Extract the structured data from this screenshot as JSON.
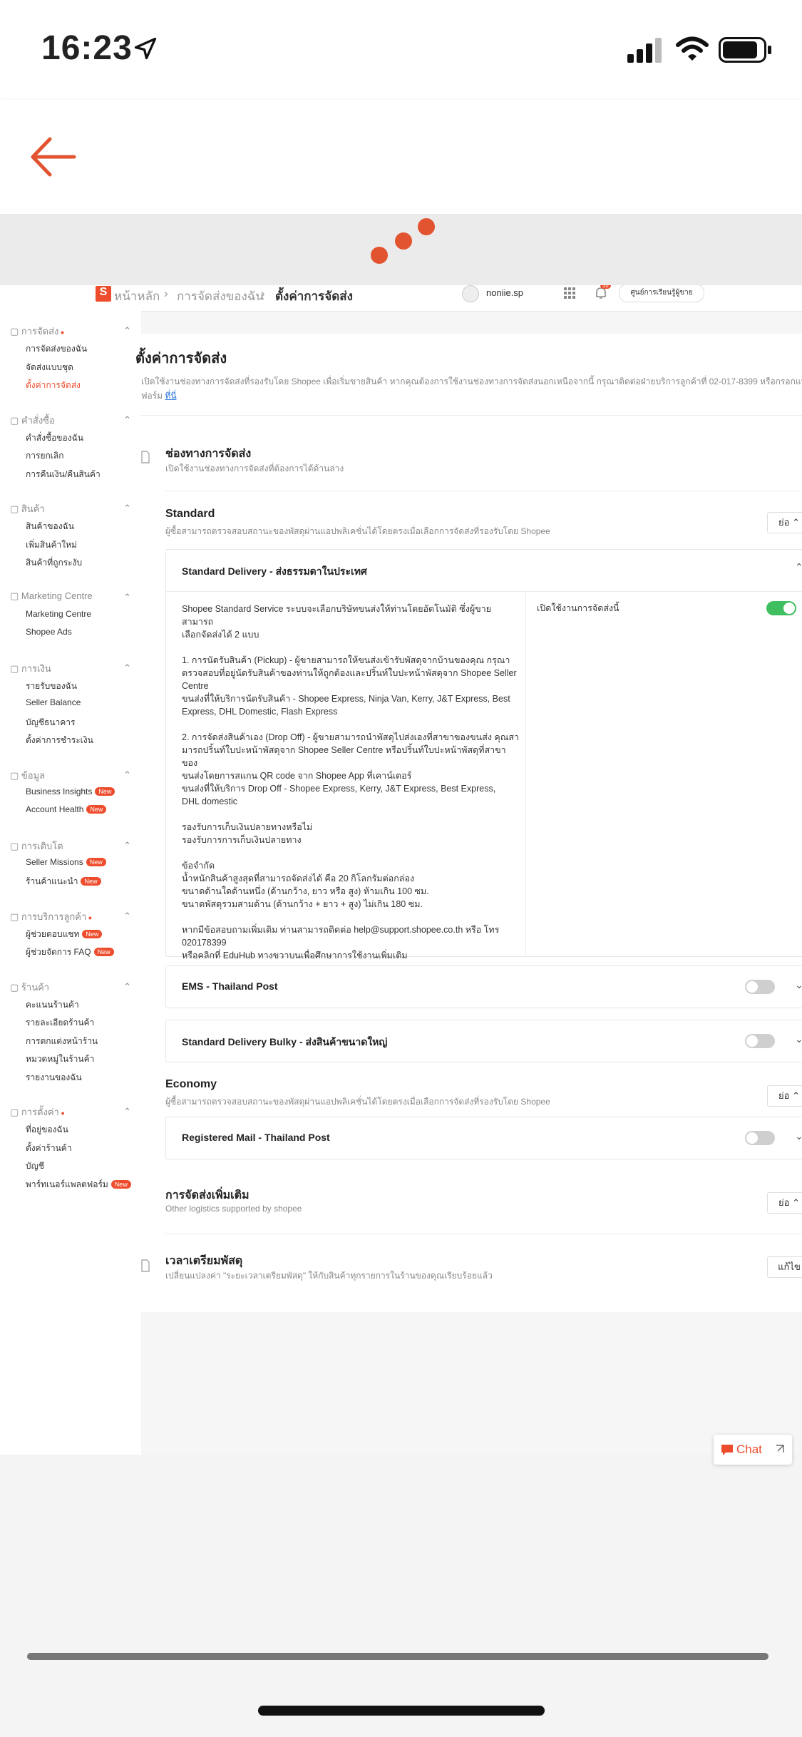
{
  "status": {
    "time": "16:23"
  },
  "breadcrumb": {
    "home_letter": "S",
    "home": "หน้าหลัก",
    "shipping": "การจัดส่งของฉัน",
    "current": "ตั้งค่าการจัดส่ง",
    "user": "noniie.sp",
    "learning": "ศูนย์การเรียนรู้ผู้ขาย",
    "notif_count": "12"
  },
  "sidebar": {
    "groups": [
      {
        "label": "การจัดส่ง",
        "items": [
          "การจัดส่งของฉัน",
          "จัดส่งแบบชุด",
          "ตั้งค่าการจัดส่ง"
        ]
      },
      {
        "label": "คำสั่งซื้อ",
        "items": [
          "คำสั่งซื้อของฉัน",
          "การยกเลิก",
          "การคืนเงิน/คืนสินค้า"
        ]
      },
      {
        "label": "สินค้า",
        "items": [
          "สินค้าของฉัน",
          "เพิ่มสินค้าใหม่",
          "สินค้าที่ถูกระงับ"
        ]
      },
      {
        "label": "Marketing Centre",
        "items": [
          "Marketing Centre",
          "Shopee Ads"
        ]
      },
      {
        "label": "การเงิน",
        "items": [
          "รายรับของฉัน",
          "Seller Balance",
          "บัญชีธนาคาร",
          "ตั้งค่าการชำระเงิน"
        ]
      },
      {
        "label": "ข้อมูล",
        "items": [
          "Business Insights",
          "Account Health"
        ]
      },
      {
        "label": "การเติบโต",
        "items": [
          "Seller Missions",
          "ร้านค้าแนะนำ"
        ]
      },
      {
        "label": "การบริการลูกค้า",
        "items": [
          "ผู้ช่วยตอบแชท",
          "ผู้ช่วยจัดการ FAQ"
        ]
      },
      {
        "label": "ร้านค้า",
        "items": [
          "คะแนนร้านค้า",
          "รายละเอียดร้านค้า",
          "การตกแต่งหน้าร้าน",
          "หมวดหมู่ในร้านค้า",
          "รายงานของฉัน"
        ]
      },
      {
        "label": "การตั้งค่า",
        "items": [
          "ที่อยู่ของฉัน",
          "ตั้งค่าร้านค้า",
          "บัญชี",
          "พาร์ทเนอร์แพลตฟอร์ม"
        ]
      }
    ],
    "new_label": "New"
  },
  "main": {
    "title": "ตั้งค่าการจัดส่ง",
    "intro": "เปิดใช้งานช่องทางการจัดส่งที่รองรับโดย Shopee เพื่อเริ่มขายสินค้า หากคุณต้องการใช้งานช่องทางการจัดส่งนอกเหนือจากนี้ กรุณาติดต่อฝ่ายบริการลูกค้าที่ 02-017-8399 หรือกรอกแบบ",
    "intro2": "ฟอร์ม",
    "intro_link": "ที่นี่",
    "channels_title": "ช่องทางการจัดส่ง",
    "channels_sub": "เปิดใช้งานช่องทางการจัดส่งที่ต้องการได้ด้านล่าง",
    "standard_title": "Standard",
    "standard_sub": "ผู้ซื้อสามารถตรวจสอบสถานะของพัสดุผ่านแอปพลิเคชั่นได้โดยตรงเมื่อเลือกการจัดส่งที่รองรับโดย Shopee",
    "collapse": "ย่อ",
    "standard_delivery": "Standard Delivery - ส่งธรรมดาในประเทศ",
    "enable_label": "เปิดใช้งานการจัดส่งนี้",
    "desc": [
      "Shopee Standard Service ระบบจะเลือกบริษัทขนส่งให้ท่านโดยอัตโนมัติ ซึ่งผู้ขายสามารถ",
      "เลือกจัดส่งได้ 2 แบบ",
      "",
      "1. การนัดรับสินค้า (Pickup) - ผู้ขายสามารถให้ขนส่งเข้ารับพัสดุจากบ้านของคุณ กรุณา",
      "ตรวจสอบที่อยู่นัดรับสินค้าของท่านให้ถูกต้องและปริ้นท์ใบปะหน้าพัสดุจาก Shopee Seller",
      "Centre",
      "ขนส่งที่ให้บริการนัดรับสินค้า - Shopee Express, Ninja Van, Kerry, J&T Express, Best",
      "Express, DHL Domestic, Flash Express",
      "",
      "2. การจัดส่งสินค้าเอง (Drop Off) - ผู้ขายสามารถนำพัสดุไปส่งเองที่สาขาของขนส่ง คุณสา",
      "มารถปริ้นท์ใบปะหน้าพัสดุจาก Shopee Seller Centre หรือปริ้นท์ใบปะหน้าพัสดุที่สาขาของ",
      "ขนส่งโดยการสแกน QR code จาก Shopee App ที่เคาน์เตอร์",
      "ขนส่งที่ให้บริการ Drop Off - Shopee Express, Kerry, J&T Express, Best Express,",
      "DHL domestic",
      "",
      "รองรับการเก็บเงินปลายทางหรือไม่",
      "รองรับการการเก็บเงินปลายทาง",
      "",
      "ข้อจำกัด",
      "น้ำหนักสินค้าสูงสุดที่สามารถจัดส่งได้ คือ 20 กิโลกรัมต่อกล่อง",
      "ขนาดด้านใดด้านหนึ่ง (ด้านกว้าง, ยาว หรือ สูง) ห้ามเกิน 100 ซม.",
      "ขนาดพัสดุรวมสามด้าน (ด้านกว้าง + ยาว + สูง) ไม่เกิน 180 ซม.",
      "",
      "หากมีข้อสอบถามเพิ่มเติม ท่านสามารถติดต่อ help@support.shopee.co.th หรือ โทร",
      "020178399",
      "หรือคลิกที่ EduHub ทางขวาบนเพื่อศึกษาการใช้งานเพิ่มเติม"
    ],
    "ems": "EMS - Thailand Post",
    "bulky": "Standard Delivery Bulky - ส่งสินค้าขนาดใหญ่",
    "economy_title": "Economy",
    "economy_sub": "ผู้ซื้อสามารถตรวจสอบสถานะของพัสดุผ่านแอปพลิเคชั่นได้โดยตรงเมื่อเลือกการจัดส่งที่รองรับโดย Shopee",
    "registered": "Registered Mail - Thailand Post",
    "extra_title": "การจัดส่งเพิ่มเติม",
    "extra_sub": "Other logistics supported by shopee",
    "prep_title": "เวลาเตรียมพัสดุ",
    "prep_sub": "เปลี่ยนแปลงค่า \"ระยะเวลาเตรียมพัสดุ\" ให้กับสินค้าทุกรายการในร้านของคุณเรียบร้อยแล้ว",
    "prep_btn": "แก้ไข"
  },
  "chat": {
    "label": "Chat"
  },
  "colors": {
    "accent": "#ee4d2d",
    "toggle_on": "#3fbf5f"
  }
}
